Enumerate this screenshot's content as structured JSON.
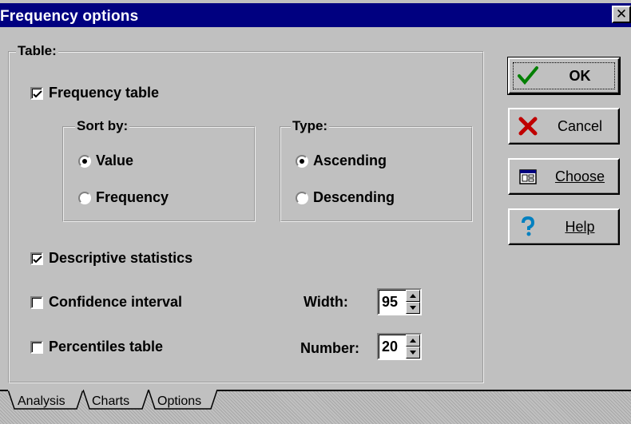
{
  "window": {
    "title": "Frequency options",
    "close_label": "✕"
  },
  "table_group": {
    "legend": "Table:",
    "frequency_table": {
      "label": "Frequency table",
      "checked": true
    },
    "sort_by": {
      "legend": "Sort by:",
      "options": [
        {
          "label": "Value",
          "selected": true
        },
        {
          "label": "Frequency",
          "selected": false
        }
      ]
    },
    "type": {
      "legend": "Type:",
      "options": [
        {
          "label": "Ascending",
          "selected": true
        },
        {
          "label": "Descending",
          "selected": false
        }
      ]
    },
    "descriptive_statistics": {
      "label": "Descriptive statistics",
      "checked": true
    },
    "confidence_interval": {
      "label": "Confidence interval",
      "checked": false
    },
    "percentiles_table": {
      "label": "Percentiles table",
      "checked": false
    },
    "width": {
      "label": "Width:",
      "value": "95"
    },
    "number": {
      "label": "Number:",
      "value": "20"
    }
  },
  "buttons": {
    "ok": {
      "label": "OK",
      "icon": "checkmark-icon"
    },
    "cancel": {
      "label": "Cancel",
      "icon": "x-icon"
    },
    "choose": {
      "label": "Choose",
      "icon": "window-icon"
    },
    "help": {
      "label": "Help",
      "icon": "question-icon"
    }
  },
  "tabs": [
    {
      "label": "Analysis",
      "active": true
    },
    {
      "label": "Charts",
      "active": false
    },
    {
      "label": "Options",
      "active": false
    }
  ],
  "colors": {
    "titlebar": "#000080",
    "face": "#c0c0c0"
  }
}
